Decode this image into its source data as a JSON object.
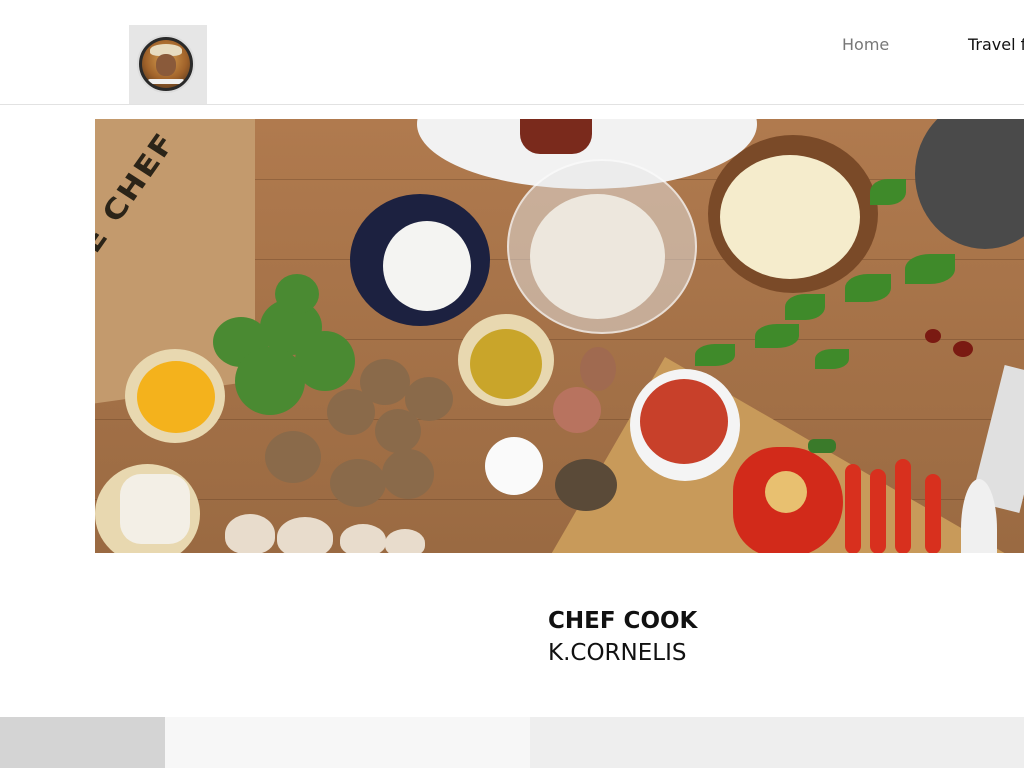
{
  "header": {
    "logo_alt": "chef-portrait-logo",
    "nav": {
      "home_label": "Home",
      "travel_label": "Travel f"
    }
  },
  "hero": {
    "image": "home-chef-ingredients-photo",
    "box_text": "ME CHEF"
  },
  "caption": {
    "title": "CHEF COOK",
    "name": "K.CORNELIS"
  },
  "colors": {
    "nav_active": "#777777",
    "nav_text": "#111111",
    "header_border": "#e2e2e2",
    "logo_bg": "#e6e6e6"
  }
}
